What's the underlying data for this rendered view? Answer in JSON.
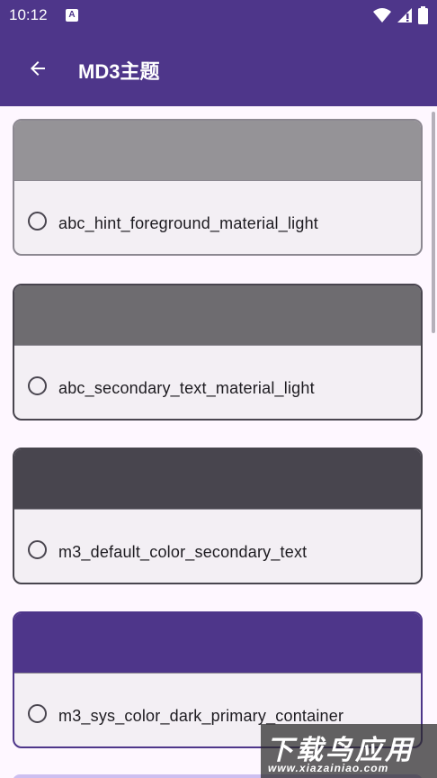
{
  "status_bar": {
    "time": "10:12",
    "notification_icon": "A",
    "icons": [
      "wifi-icon",
      "signal-icon",
      "battery-icon"
    ]
  },
  "app_bar": {
    "title": "MD3主题",
    "back_icon": "arrow-left-icon"
  },
  "colors": {
    "primary": "#4E368A",
    "background": "#FEF7FF",
    "card_surface": "#F3EFF4"
  },
  "themes": [
    {
      "name": "abc_hint_foreground_material_light",
      "color": "#959397",
      "selected": false
    },
    {
      "name": "abc_secondary_text_material_light",
      "color": "#6E6C70",
      "selected": false
    },
    {
      "name": "m3_default_color_secondary_text",
      "color": "#48454E",
      "selected": false
    },
    {
      "name": "m3_sys_color_dark_primary_container",
      "color": "#4E368A",
      "selected": false
    }
  ],
  "watermark": {
    "title": "下载鸟应用",
    "url": "www.xiazainiao.com"
  }
}
